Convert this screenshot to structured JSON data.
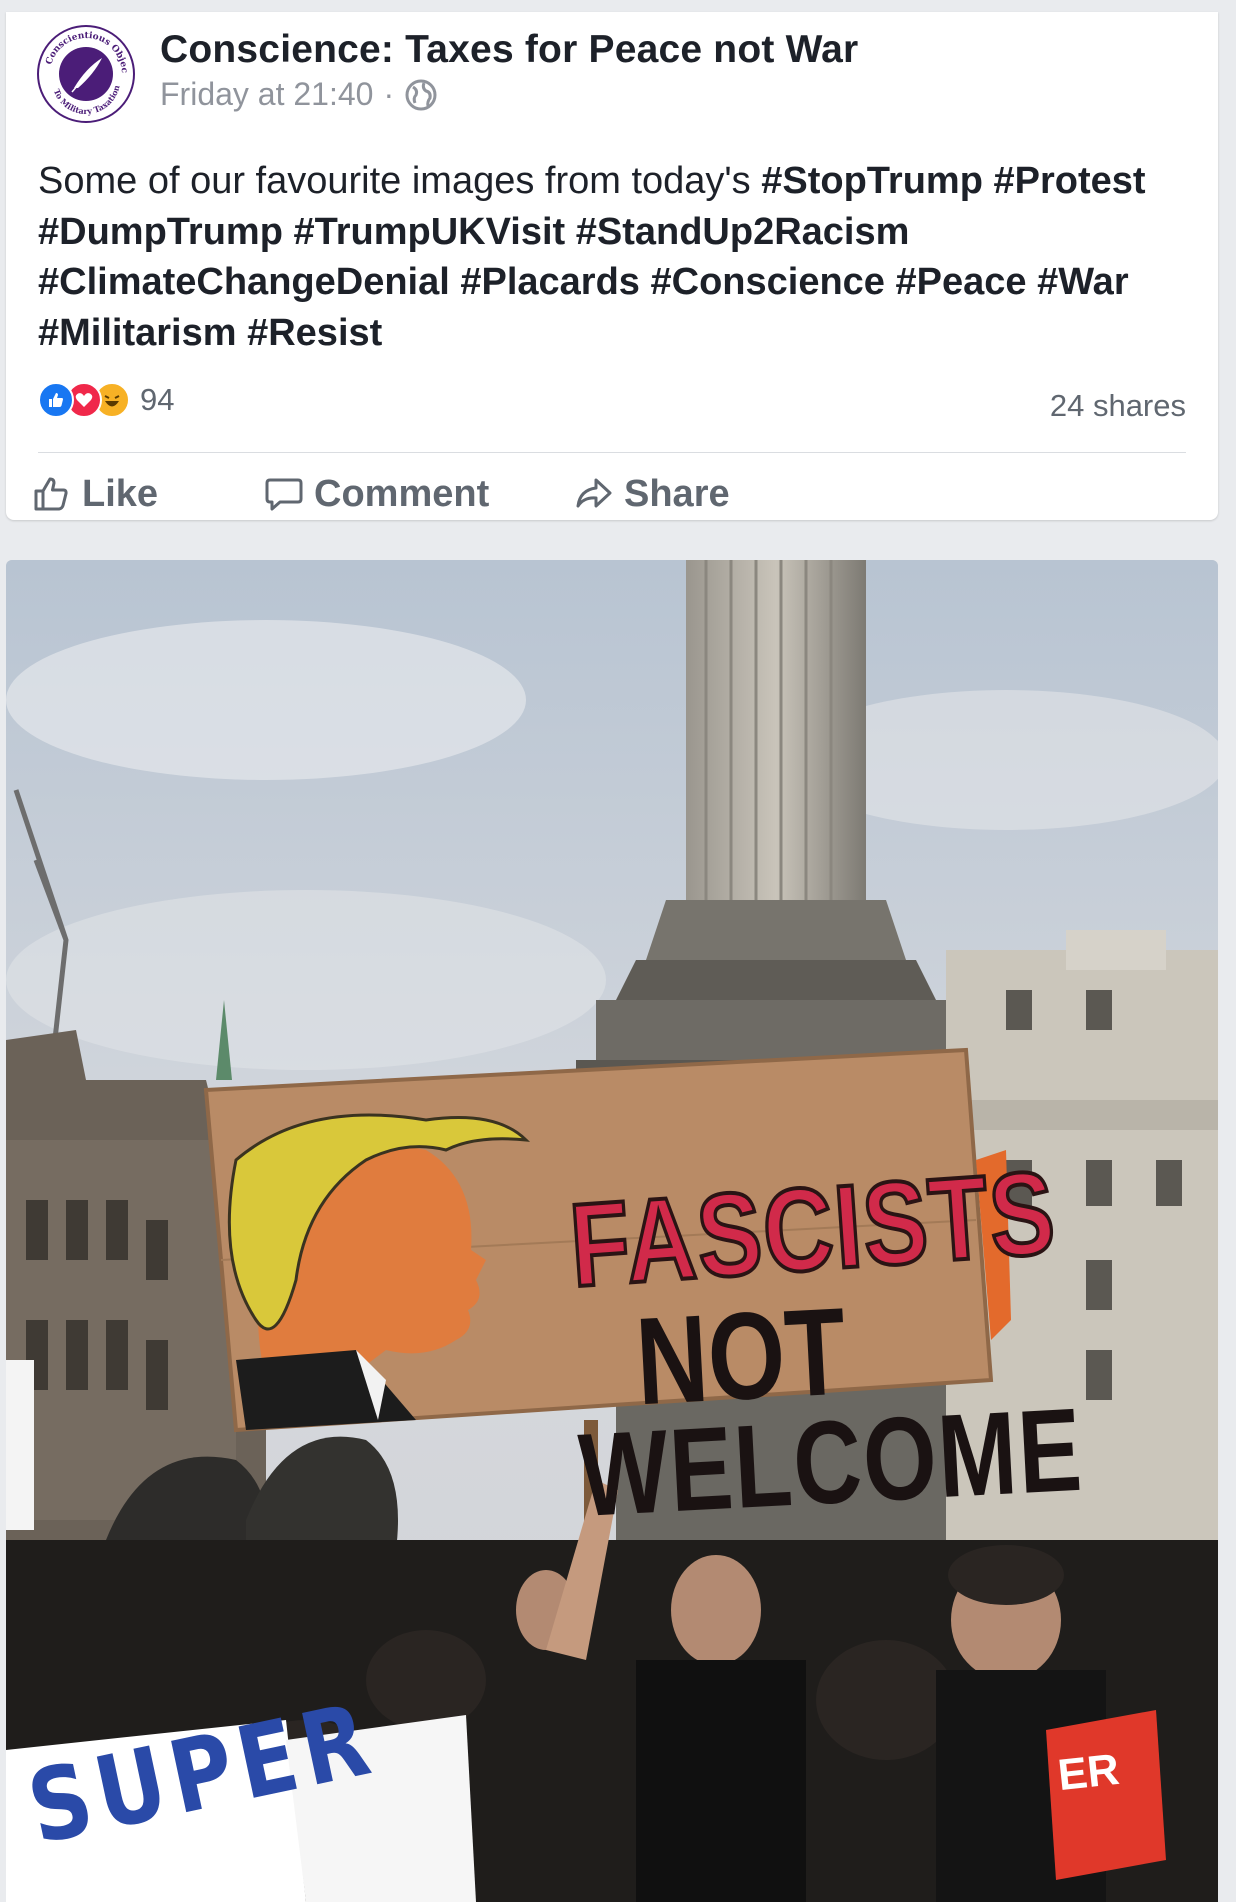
{
  "post": {
    "page_name": "Conscience: Taxes for Peace not War",
    "timestamp": "Friday at 21:40",
    "separator": "·",
    "privacy_icon": "globe-icon",
    "avatar_ring_text_top": "Conscientious Objector",
    "avatar_ring_text_bottom": "To Military Taxation",
    "text_prefix": "Some of our favourite images from today's ",
    "hashtags": [
      "#StopTrump",
      "#Protest",
      "#DumpTrump",
      "#TrumpUKVisit",
      "#StandUp2Racism",
      "#ClimateChangeDenial",
      "#Placards",
      "#Conscience",
      "#Peace",
      "#War",
      "#Militarism",
      "#Resist"
    ],
    "reaction_icons": [
      "like-icon",
      "love-icon",
      "haha-icon"
    ],
    "reaction_count": "94",
    "shares": "24 shares"
  },
  "actions": {
    "like_label": "Like",
    "comment_label": "Comment",
    "share_label": "Share"
  },
  "photo": {
    "sign_line1": "FASCISTS",
    "sign_line2": "NOT",
    "sign_line3": "WELCOME",
    "placard_text": "SUPER",
    "banner_text": "ER"
  },
  "colors": {
    "background": "#e9ebee",
    "card": "#ffffff",
    "text_primary": "#1d2129",
    "text_secondary": "#606770",
    "like_blue": "#1877f2",
    "love_red": "#f0284a",
    "haha_yellow": "#f7b125",
    "avatar_purple": "#4b1d78"
  }
}
